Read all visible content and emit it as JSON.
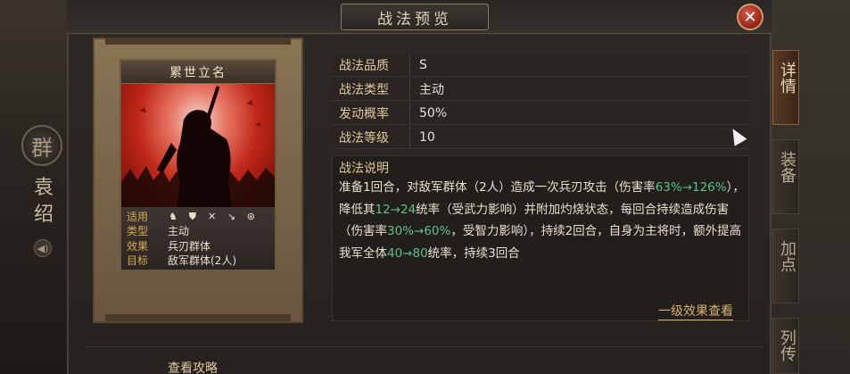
{
  "window": {
    "title": "战法预览",
    "close_label": "✕"
  },
  "faction": {
    "glyph": "群",
    "name": "袁绍",
    "sound_icon": "speaker-icon"
  },
  "side_tabs": [
    {
      "label": "详情",
      "active": true
    },
    {
      "label": "装备",
      "active": false
    },
    {
      "label": "加点",
      "active": false
    },
    {
      "label": "列传",
      "active": false
    }
  ],
  "card": {
    "title": "累世立名",
    "troop_icons": [
      "cavalry-icon",
      "shield-icon",
      "bow-icon",
      "spear-icon",
      "siege-icon"
    ],
    "info": [
      {
        "key": "适用",
        "value": ""
      },
      {
        "key": "类型",
        "value": "主动"
      },
      {
        "key": "效果",
        "value": "兵刃群体"
      },
      {
        "key": "目标",
        "value": "敌军群体(2人)"
      }
    ]
  },
  "attributes": [
    {
      "key": "战法品质",
      "value": "S"
    },
    {
      "key": "战法类型",
      "value": "主动"
    },
    {
      "key": "发动概率",
      "value": "50%"
    },
    {
      "key": "战法等级",
      "value": "10"
    }
  ],
  "description": {
    "title": "战法说明",
    "parts": [
      {
        "text": "准备1回合，对敌军群体（2人）造成一次兵刃攻击（伤害率",
        "green": false
      },
      {
        "text": "63%→126%",
        "green": true
      },
      {
        "text": "），降低其",
        "green": false
      },
      {
        "text": "12→24",
        "green": true
      },
      {
        "text": "统率（受武力影响）并附加灼烧状态，每回合持续造成伤害（伤害率",
        "green": false
      },
      {
        "text": "30%→60%",
        "green": true
      },
      {
        "text": "，受智力影响），持续2回合，自身为主将时，额外提高我军全体",
        "green": false
      },
      {
        "text": "40→80",
        "green": true
      },
      {
        "text": "统率，持续3回合",
        "green": false
      }
    ]
  },
  "effect_link": "一级效果查看",
  "bottom_link": "查看攻略",
  "colors": {
    "accent_gold": "#e0c89a",
    "value_green": "#5ec08a",
    "close_red": "#a02a1c"
  }
}
